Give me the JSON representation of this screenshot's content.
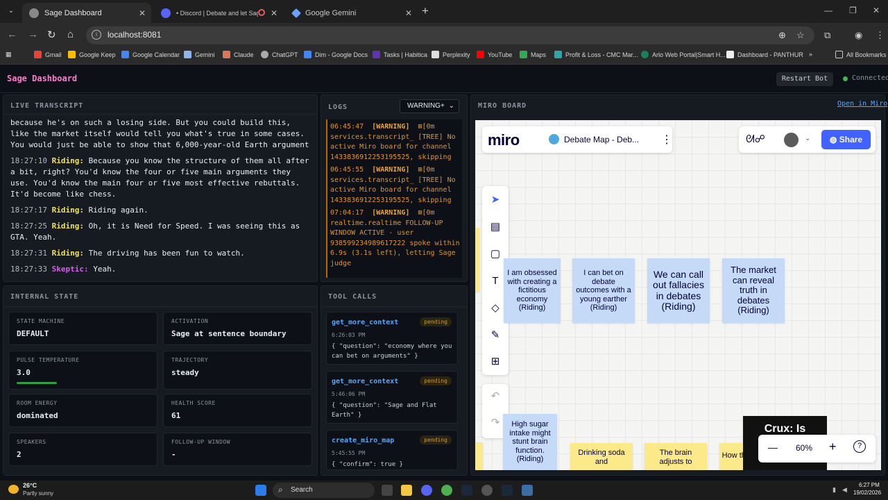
{
  "browser": {
    "tabs": [
      {
        "title": "Sage Dashboard",
        "active": true
      },
      {
        "title": "• Discord | Debate and let Sage t",
        "active": false
      },
      {
        "title": "Google Gemini",
        "active": false
      }
    ],
    "url": "localhost:8081",
    "bookmarks": [
      "Gmail",
      "Google Keep",
      "Google Calendar",
      "Gemini",
      "Claude",
      "ChatGPT",
      "Dim - Google Docs",
      "Tasks | Habitica",
      "Perplexity",
      "YouTube",
      "Maps",
      "Profit & Loss - CMC Mar...",
      "Arlo Web Portal|Smart H...",
      "Dashboard - PANTHUR"
    ],
    "all_bookmarks": "All Bookmarks"
  },
  "app": {
    "title": "Sage Dashboard",
    "restart_label": "Restart Bot",
    "status": "Connected",
    "accent_color": "#ff7bd0"
  },
  "transcript": {
    "title": "LIVE TRANSCRIPT",
    "lead_text": "because he's on such a losing side. But you could build this, like the market itself would tell you what's true in some cases. You would just be able to show that 6,000-year-old Earth argument",
    "lines": [
      {
        "time": "18:27:10",
        "speaker": "Riding:",
        "text": "Because you know the structure of them all after a bit, right? You'd know the four or five main arguments they use. You'd know the main four or five most effective rebuttals. It'd become like chess."
      },
      {
        "time": "18:27:17",
        "speaker": "Riding:",
        "text": "Riding again."
      },
      {
        "time": "18:27:25",
        "speaker": "Riding:",
        "text": "Oh, it is Need for Speed. I was seeing this as GTA. Yeah."
      },
      {
        "time": "18:27:31",
        "speaker": "Riding:",
        "text": "The driving has been fun to watch."
      },
      {
        "time": "18:27:33",
        "speaker": "Skeptic:",
        "text": "Yeah."
      }
    ]
  },
  "logs": {
    "title": "LOGS",
    "filter": "WARNING+",
    "entries": [
      {
        "time": "06:45:47",
        "level": "[WARNING]",
        "text": "⊠[0m services.transcript_ [TREE] No active Miro board for channel 1433836912253195525, skipping"
      },
      {
        "time": "06:45:55",
        "level": "[WARNING]",
        "text": "⊠[0m services.transcript_ [TREE] No active Miro board for channel 1433836912253195525, skipping"
      },
      {
        "time": "07:04:17",
        "level": "[WARNING]",
        "text": "⊠[0m realtime.realtime FOLLOW-UP WINDOW ACTIVE - user 938599234989617222 spoke within 6.9s (3.1s left), letting Sage judge"
      }
    ]
  },
  "internal_state": {
    "title": "INTERNAL STATE",
    "cards": [
      {
        "label": "STATE MACHINE",
        "value": "DEFAULT"
      },
      {
        "label": "ACTIVATION",
        "value": "Sage at sentence boundary"
      },
      {
        "label": "PULSE TEMPERATURE",
        "value": "3.0"
      },
      {
        "label": "TRAJECTORY",
        "value": "steady"
      },
      {
        "label": "ROOM ENERGY",
        "value": "dominated"
      },
      {
        "label": "HEALTH SCORE",
        "value": "61"
      },
      {
        "label": "SPEAKERS",
        "value": "2"
      },
      {
        "label": "FOLLOW-UP WINDOW",
        "value": "-"
      }
    ]
  },
  "tool_calls": {
    "title": "TOOL CALLS",
    "items": [
      {
        "name": "get_more_context",
        "status": "pending",
        "time": "6:26:03 PM",
        "args": "{ \"question\": \"economy where you can bet on arguments\" }"
      },
      {
        "name": "get_more_context",
        "status": "pending",
        "time": "5:46:06 PM",
        "args": "{ \"question\": \"Sage and Flat Earth\" }"
      },
      {
        "name": "create_miro_map",
        "status": "pending",
        "time": "5:45:55 PM",
        "args": "{ \"confirm\": true }"
      }
    ]
  },
  "miro": {
    "title": "MIRO BOARD",
    "open_label": "Open in Miro",
    "logo": "miro",
    "board_name": "Debate Map - Deb...",
    "share_label": "Share",
    "zoom": "60%",
    "stickies_top": [
      {
        "text": "I am obsessed with creating a fictitious economy",
        "author": "(Riding)"
      },
      {
        "text": "I can bet on debate outcomes with a young earther",
        "author": "(Riding)"
      },
      {
        "text": "We can call out fallacies in debates",
        "author": "(Riding)"
      },
      {
        "text": "The market can reveal truth in debates",
        "author": "(Riding)"
      }
    ],
    "stickies_bottom": [
      {
        "text": "High sugar intake might stunt brain function.",
        "author": "(Riding)"
      },
      {
        "text": "Drinking soda and",
        "author": ""
      },
      {
        "text": "The brain adjusts to",
        "author": ""
      },
      {
        "text": "How thi",
        "author": ""
      }
    ],
    "crux": "Crux: Is"
  },
  "taskbar": {
    "temp": "26°C",
    "weather": "Partly sunny",
    "search": "Search",
    "time": "6:27 PM",
    "date": "19/02/2026"
  }
}
